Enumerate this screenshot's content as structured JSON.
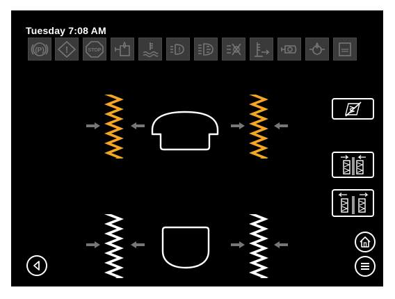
{
  "status": {
    "datetime": "Tuesday 7:08 AM"
  },
  "warning_icons": [
    {
      "name": "parking-brake-icon",
      "label": "(P)"
    },
    {
      "name": "general-warning-icon",
      "label": "!"
    },
    {
      "name": "stop-icon",
      "label": "STOP"
    },
    {
      "name": "hydraulic-oil-icon"
    },
    {
      "name": "coolant-temp-icon"
    },
    {
      "name": "front-brake-icon",
      "label": "!"
    },
    {
      "name": "transmission-icon"
    },
    {
      "name": "trailer-brake-icon"
    },
    {
      "name": "fuel-level-icon"
    },
    {
      "name": "engine-oil-icon"
    },
    {
      "name": "oil-pressure-icon"
    },
    {
      "name": "def-icon"
    }
  ],
  "colors": {
    "selected_tire": "#f5a623",
    "unselected_tire": "#ffffff",
    "warning_bg": "#3a3a3a",
    "arrow": "#777777",
    "background": "#000000"
  },
  "axles": [
    {
      "name": "front-axle",
      "selected": true
    },
    {
      "name": "rear-axle",
      "selected": false
    }
  ],
  "controls": [
    {
      "name": "tire-pressure-off-button",
      "icon": "tire-slash-icon"
    },
    {
      "name": "inflate-button",
      "icon": "tires-inward-icon"
    },
    {
      "name": "deflate-button",
      "icon": "tires-outward-icon"
    }
  ],
  "nav": [
    {
      "name": "back-button",
      "icon": "chevron-left-icon"
    },
    {
      "name": "home-button",
      "icon": "home-icon"
    },
    {
      "name": "menu-button",
      "icon": "menu-icon"
    }
  ]
}
